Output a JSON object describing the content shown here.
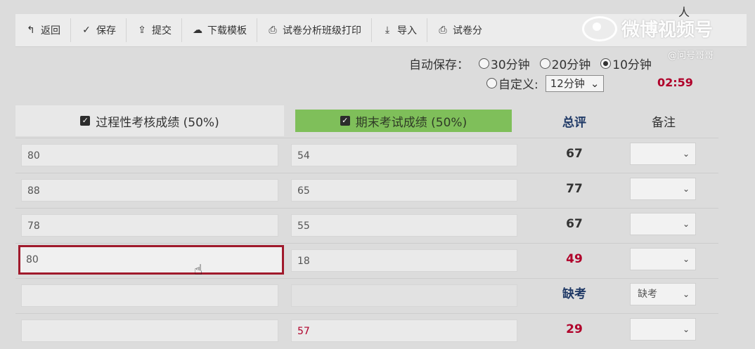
{
  "toolbar": {
    "items": [
      {
        "label": "返回",
        "icon": "back-arrow-icon"
      },
      {
        "label": "保存",
        "icon": "check-save-icon"
      },
      {
        "label": "提交",
        "icon": "upload-icon"
      },
      {
        "label": "下载模板",
        "icon": "cloud-download-icon"
      },
      {
        "label": "试卷分析班级打印",
        "icon": "printer-icon"
      },
      {
        "label": "导入",
        "icon": "import-icon"
      },
      {
        "label": "试卷分",
        "icon": "printer-icon"
      }
    ]
  },
  "watermark": {
    "title": "微博视频号",
    "sub": "@问号哥哥",
    "corner": "人"
  },
  "autosave": {
    "label": "自动保存：",
    "options": [
      "30分钟",
      "20分钟",
      "10分钟"
    ],
    "selected": "10分钟",
    "custom_label": "自定义:",
    "custom_value": "12分钟",
    "countdown": "02:59"
  },
  "headers": {
    "process": "过程性考核成绩 (50%)",
    "final": "期末考试成绩 (50%)",
    "total": "总评",
    "remark": "备注"
  },
  "rows": [
    {
      "process": "80",
      "final": "54",
      "total": "67",
      "remark": ""
    },
    {
      "process": "88",
      "final": "65",
      "total": "77",
      "remark": ""
    },
    {
      "process": "78",
      "final": "55",
      "total": "67",
      "remark": ""
    },
    {
      "process": "80",
      "final": "18",
      "total": "49",
      "remark": ""
    },
    {
      "process": "",
      "final": "",
      "total": "缺考",
      "remark": "缺考"
    },
    {
      "process": "",
      "final": "57",
      "total": "29",
      "remark": ""
    }
  ],
  "colors": {
    "accent_red": "#b0002a",
    "header_green": "#7fbf5a",
    "total_blue": "#1f3966"
  }
}
